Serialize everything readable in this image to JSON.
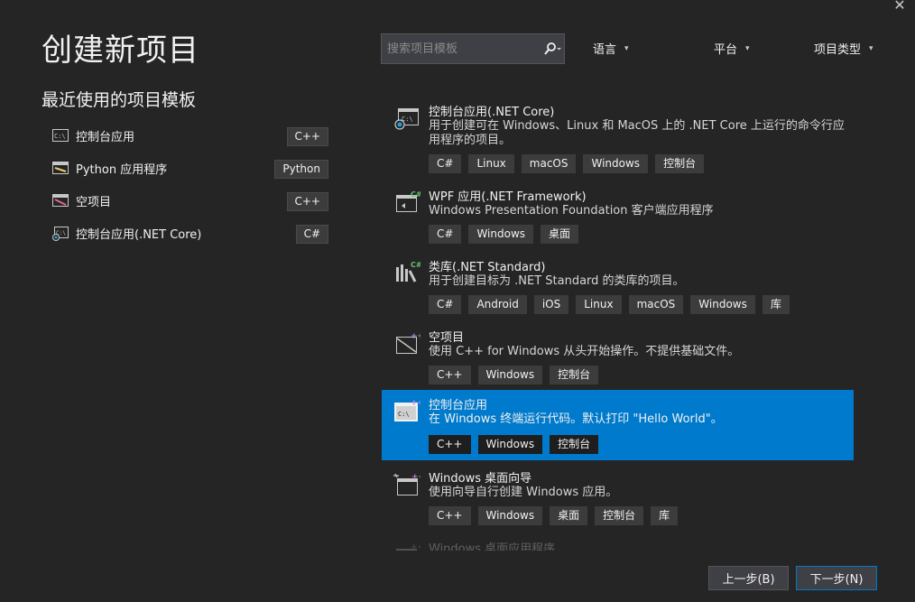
{
  "window": {
    "close_glyph": "✕"
  },
  "page": {
    "title": "创建新项目"
  },
  "recent": {
    "title": "最近使用的项目模板",
    "items": [
      {
        "label": "控制台应用",
        "lang": "C++",
        "icon": "console-icon"
      },
      {
        "label": "Python 应用程序",
        "lang": "Python",
        "icon": "python-app-icon"
      },
      {
        "label": "空项目",
        "lang": "C++",
        "icon": "empty-project-icon"
      },
      {
        "label": "控制台应用(.NET Core)",
        "lang": "C#",
        "icon": "console-netcore-icon"
      }
    ]
  },
  "search": {
    "placeholder": "搜索项目模板",
    "value": ""
  },
  "filters": {
    "language": "语言",
    "platform": "平台",
    "project_type": "项目类型"
  },
  "templates": [
    {
      "name": "控制台应用(.NET Core)",
      "desc": "用于创建可在 Windows、Linux 和 MacOS 上的 .NET Core 上运行的命令行应用程序的项目。",
      "tags": [
        "C#",
        "Linux",
        "macOS",
        "Windows",
        "控制台"
      ],
      "icon": "console-netcore-icon"
    },
    {
      "name": "WPF 应用(.NET Framework)",
      "desc": "Windows Presentation Foundation 客户端应用程序",
      "tags": [
        "C#",
        "Windows",
        "桌面"
      ],
      "icon": "wpf-app-icon"
    },
    {
      "name": "类库(.NET Standard)",
      "desc": "用于创建目标为 .NET Standard 的类库的项目。",
      "tags": [
        "C#",
        "Android",
        "iOS",
        "Linux",
        "macOS",
        "Windows",
        "库"
      ],
      "icon": "class-library-icon"
    },
    {
      "name": "空项目",
      "desc": "使用 C++ for Windows 从头开始操作。不提供基础文件。",
      "tags": [
        "C++",
        "Windows",
        "控制台"
      ],
      "icon": "empty-project-icon"
    },
    {
      "name": "控制台应用",
      "desc": "在 Windows 终端运行代码。默认打印 \"Hello World\"。",
      "tags": [
        "C++",
        "Windows",
        "控制台"
      ],
      "icon": "console-cpp-icon",
      "selected": true
    },
    {
      "name": "Windows 桌面向导",
      "desc": "使用向导自行创建 Windows 应用。",
      "tags": [
        "C++",
        "Windows",
        "桌面",
        "控制台",
        "库"
      ],
      "icon": "windows-desktop-wizard-icon"
    },
    {
      "name": "Windows 桌面应用程序",
      "desc": "",
      "tags": [],
      "icon": "windows-desktop-app-icon"
    }
  ],
  "buttons": {
    "back": "上一步(B)",
    "next": "下一步(N)"
  },
  "colors": {
    "background": "#252526",
    "accent": "#007acc",
    "tag_bg": "#3c3c3c",
    "text": "#f1f1f1"
  }
}
